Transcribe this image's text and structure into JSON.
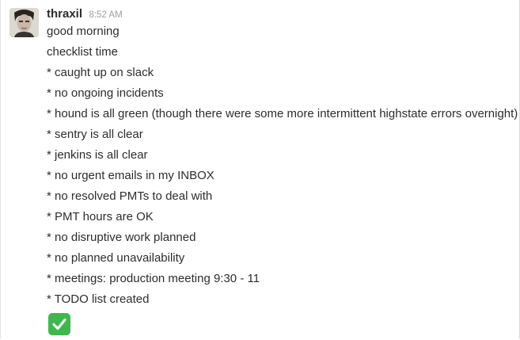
{
  "message": {
    "username": "thraxil",
    "timestamp": "8:52 AM",
    "lines": [
      "good morning",
      "checklist time",
      "* caught up on slack",
      "* no ongoing incidents",
      "* hound is all green (though there were some more intermittent highstate errors overnight)",
      "* sentry is all clear",
      "* jenkins is all clear",
      "* no urgent emails in my INBOX",
      "* no resolved PMTs to deal with",
      "* PMT hours are OK",
      "* no disruptive work planned",
      "* no planned unavailability",
      "* meetings: production meeting 9:30 - 11",
      "* TODO list created"
    ],
    "emoji": "white-check-mark-icon"
  },
  "colors": {
    "username": "#2c2d30",
    "timestamp": "#9e9ea6",
    "text": "#2c2d30",
    "emoji_bg": "#3db84a"
  }
}
